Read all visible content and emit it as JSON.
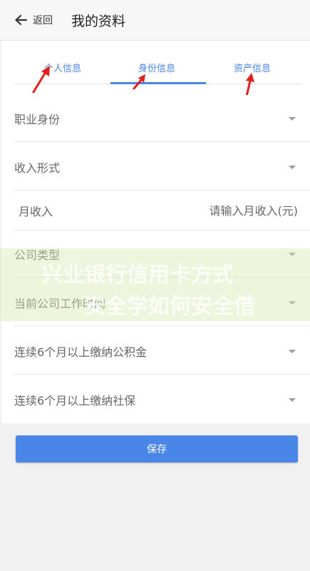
{
  "header": {
    "back_label": "返回",
    "title": "我的资料"
  },
  "tabs": [
    {
      "label": "个人信息"
    },
    {
      "label": "身份信息"
    },
    {
      "label": "资产信息"
    }
  ],
  "active_tab": "身份信息",
  "form": {
    "occupation": "职业身份",
    "income_type": "收入形式",
    "monthly_income_label": "月收入",
    "monthly_income_placeholder": "请输入月收入(元)",
    "company_type": "公司类型",
    "work_duration": "当前公司工作时间",
    "housing_fund": "连续6个月以上缴纳公积金",
    "social_security": "连续6个月以上缴纳社保"
  },
  "save_label": "保存",
  "watermark": {
    "line1": "兴业银行信用卡方式",
    "line2": "安全学如何安全借"
  },
  "colors": {
    "accent": "#4a86e8",
    "arrow": "#e02020"
  }
}
